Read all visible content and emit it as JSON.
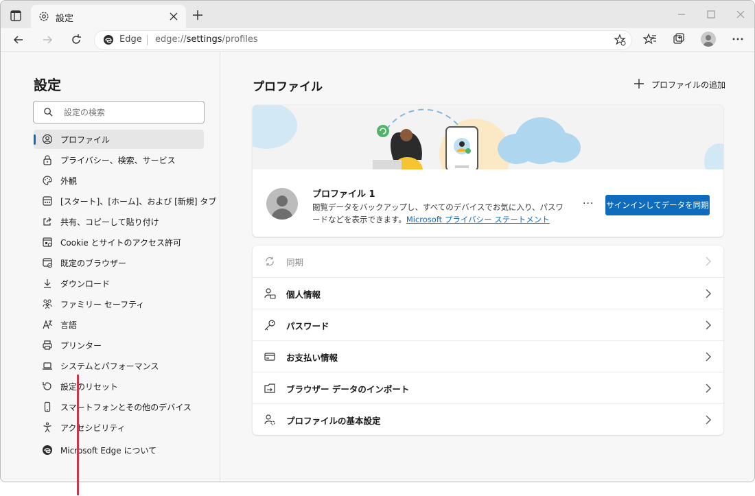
{
  "tab": {
    "title": "設定"
  },
  "address": {
    "brand": "Edge",
    "url_prefix": "edge://",
    "url_bold": "settings",
    "url_suffix": "/profiles"
  },
  "sidebar": {
    "title": "設定",
    "search_placeholder": "設定の検索",
    "items": [
      {
        "label": "プロファイル",
        "icon": "profile-icon",
        "active": true
      },
      {
        "label": "プライバシー、検索、サービス",
        "icon": "lock-icon"
      },
      {
        "label": "外観",
        "icon": "palette-icon"
      },
      {
        "label": "[スタート]、[ホーム]、および [新規] タブ",
        "icon": "home-tab-icon"
      },
      {
        "label": "共有、コピーして貼り付け",
        "icon": "share-icon"
      },
      {
        "label": "Cookie とサイトのアクセス許可",
        "icon": "site-permissions-icon"
      },
      {
        "label": "既定のブラウザー",
        "icon": "default-browser-icon"
      },
      {
        "label": "ダウンロード",
        "icon": "download-icon"
      },
      {
        "label": "ファミリー セーフティ",
        "icon": "family-icon"
      },
      {
        "label": "言語",
        "icon": "language-icon"
      },
      {
        "label": "プリンター",
        "icon": "printer-icon"
      },
      {
        "label": "システムとパフォーマンス",
        "icon": "laptop-icon"
      },
      {
        "label": "設定のリセット",
        "icon": "reset-icon"
      },
      {
        "label": "スマートフォンとその他のデバイス",
        "icon": "phone-icon"
      },
      {
        "label": "アクセシビリティ",
        "icon": "accessibility-icon"
      },
      {
        "label": "Microsoft Edge について",
        "icon": "edge-logo-icon"
      }
    ]
  },
  "main": {
    "title": "プロファイル",
    "add_profile": "プロファイルの追加",
    "profile": {
      "name": "プロファイル 1",
      "description": "閲覧データをバックアップし、すべてのデバイスでお気に入り、パスワードなどを表示できます。",
      "privacy_link": "Microsoft プライバシー ステートメント",
      "more": "···",
      "signin_button": "サインインしてデータを同期"
    },
    "rows": [
      {
        "label": "同期",
        "icon": "sync-icon",
        "disabled": true
      },
      {
        "label": "個人情報",
        "icon": "personal-info-icon"
      },
      {
        "label": "パスワード",
        "icon": "key-icon"
      },
      {
        "label": "お支払い情報",
        "icon": "credit-card-icon"
      },
      {
        "label": "ブラウザー データのインポート",
        "icon": "import-icon"
      },
      {
        "label": "プロファイルの基本設定",
        "icon": "profile-settings-icon"
      }
    ]
  },
  "colors": {
    "accent": "#0f6cbd",
    "annotation_line": "#c9384a"
  }
}
